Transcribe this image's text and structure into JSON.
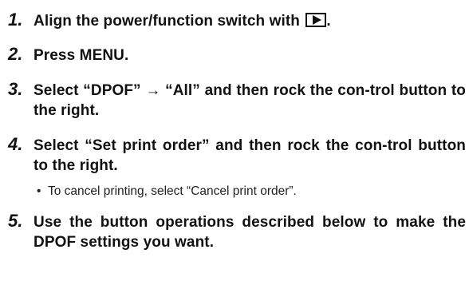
{
  "steps": [
    {
      "number": "1.",
      "text": "Align the power/function switch with",
      "trail": ".",
      "icon": "play-mode-icon"
    },
    {
      "number": "2.",
      "text": "Press MENU."
    },
    {
      "number": "3.",
      "text": "Select “DPOF” → “All” and then rock the con-trol button to the right."
    },
    {
      "number": "4.",
      "text": "Select “Set print order” and then rock the con-trol button to the right.",
      "bullet": {
        "symbol": "•",
        "text": "To cancel printing, select “Cancel print order”."
      }
    },
    {
      "number": "5.",
      "text": "Use the button operations described below to make the DPOF settings you want."
    }
  ]
}
